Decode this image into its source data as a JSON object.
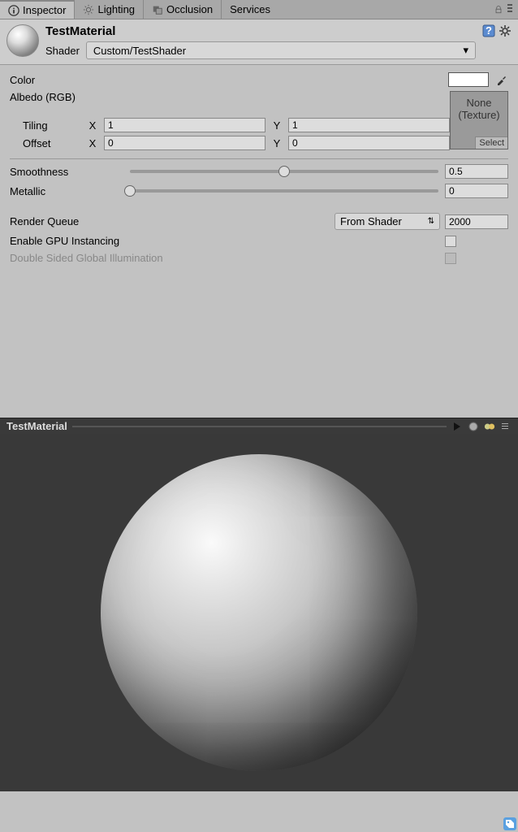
{
  "tabs": {
    "inspector": "Inspector",
    "lighting": "Lighting",
    "occlusion": "Occlusion",
    "services": "Services"
  },
  "header": {
    "material_name": "TestMaterial",
    "shader_label": "Shader",
    "shader_value": "Custom/TestShader"
  },
  "props": {
    "color_label": "Color",
    "color_value": "#ffffff",
    "albedo_label": "Albedo (RGB)",
    "tex_none": "None",
    "tex_type": "(Texture)",
    "tex_select": "Select",
    "tiling_label": "Tiling",
    "offset_label": "Offset",
    "x_label": "X",
    "y_label": "Y",
    "tiling_x": "1",
    "tiling_y": "1",
    "offset_x": "0",
    "offset_y": "0",
    "smoothness_label": "Smoothness",
    "smoothness_value": "0.5",
    "metallic_label": "Metallic",
    "metallic_value": "0",
    "render_queue_label": "Render Queue",
    "render_queue_mode": "From Shader",
    "render_queue_value": "2000",
    "gpu_instancing_label": "Enable GPU Instancing",
    "dsgi_label": "Double Sided Global Illumination"
  },
  "preview": {
    "title": "TestMaterial"
  }
}
